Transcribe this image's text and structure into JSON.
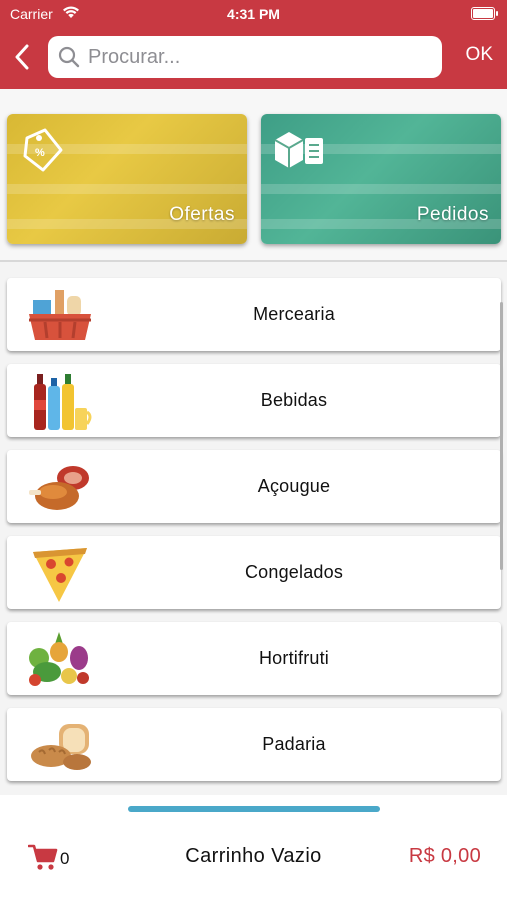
{
  "status_bar": {
    "carrier": "Carrier",
    "time": "4:31 PM"
  },
  "nav": {
    "search_placeholder": "Procurar...",
    "ok_label": "OK",
    "accent_color": "#c83942"
  },
  "cards": [
    {
      "label": "Ofertas",
      "icon": "price-tag-icon",
      "color": "#d8b834"
    },
    {
      "label": "Pedidos",
      "icon": "boxes-checklist-icon",
      "color": "#3e9e86"
    }
  ],
  "categories": [
    {
      "label": "Mercearia",
      "icon": "grocery-basket-icon"
    },
    {
      "label": "Bebidas",
      "icon": "drinks-bottles-icon"
    },
    {
      "label": "Açougue",
      "icon": "meat-poultry-icon"
    },
    {
      "label": "Congelados",
      "icon": "pizza-slice-icon"
    },
    {
      "label": "Hortifruti",
      "icon": "fruits-vegetables-icon"
    },
    {
      "label": "Padaria",
      "icon": "bread-icon"
    }
  ],
  "cart": {
    "count": "0",
    "title": "Carrinho Vazio",
    "total": "R$ 0,00",
    "icon": "cart-icon"
  }
}
